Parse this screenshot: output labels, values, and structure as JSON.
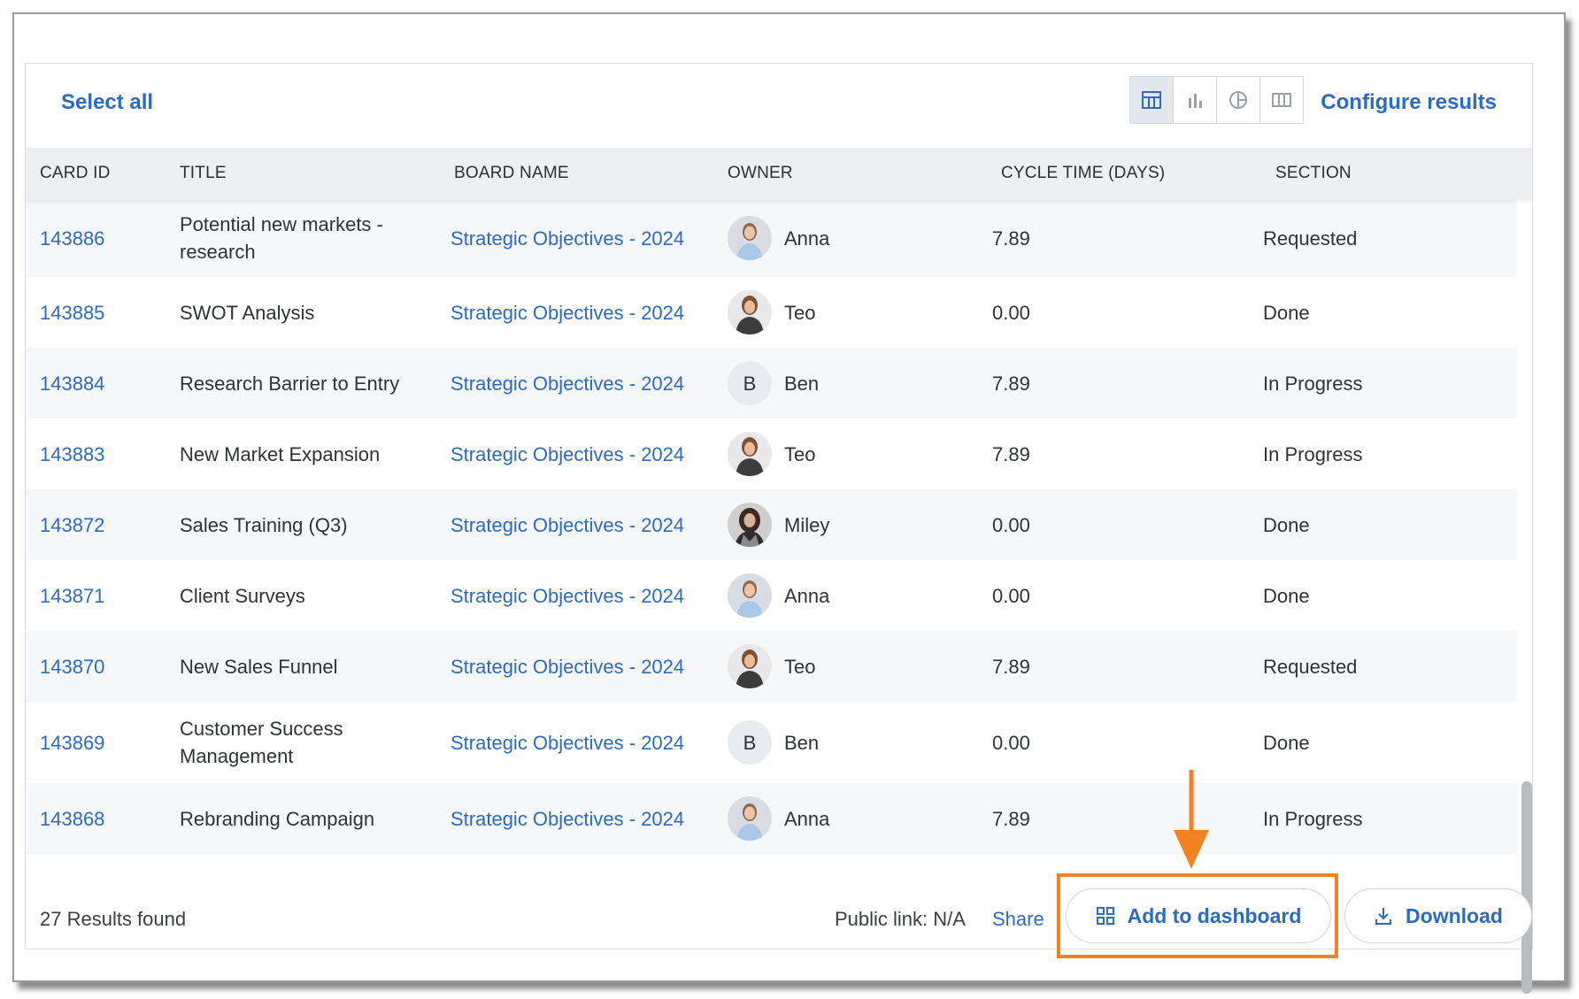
{
  "toolbar": {
    "select_all": "Select all",
    "configure_results": "Configure results",
    "view_modes": [
      "table-view-icon",
      "bar-chart-icon",
      "pie-chart-icon",
      "columns-view-icon"
    ]
  },
  "table": {
    "headers": {
      "card_id": "CARD ID",
      "title": "TITLE",
      "board_name": "BOARD NAME",
      "owner": "OWNER",
      "cycle_time": "CYCLE TIME (DAYS)",
      "section": "SECTION"
    },
    "rows": [
      {
        "card_id": "143886",
        "title": "Potential new markets - research",
        "board": "Strategic Objectives - 2024",
        "owner": "Anna",
        "avatar": "photo-anna",
        "cycle": "7.89",
        "section": "Requested"
      },
      {
        "card_id": "143885",
        "title": "SWOT Analysis",
        "board": "Strategic Objectives - 2024",
        "owner": "Teo",
        "avatar": "photo-teo",
        "cycle": "0.00",
        "section": "Done"
      },
      {
        "card_id": "143884",
        "title": "Research Barrier to Entry",
        "board": "Strategic Objectives - 2024",
        "owner": "Ben",
        "avatar": "B",
        "cycle": "7.89",
        "section": "In Progress"
      },
      {
        "card_id": "143883",
        "title": "New Market Expansion",
        "board": "Strategic Objectives - 2024",
        "owner": "Teo",
        "avatar": "photo-teo",
        "cycle": "7.89",
        "section": "In Progress"
      },
      {
        "card_id": "143872",
        "title": "Sales Training (Q3)",
        "board": "Strategic Objectives - 2024",
        "owner": "Miley",
        "avatar": "photo-miley",
        "cycle": "0.00",
        "section": "Done"
      },
      {
        "card_id": "143871",
        "title": "Client Surveys",
        "board": "Strategic Objectives - 2024",
        "owner": "Anna",
        "avatar": "photo-anna",
        "cycle": "0.00",
        "section": "Done"
      },
      {
        "card_id": "143870",
        "title": "New Sales Funnel",
        "board": "Strategic Objectives - 2024",
        "owner": "Teo",
        "avatar": "photo-teo",
        "cycle": "7.89",
        "section": "Requested"
      },
      {
        "card_id": "143869",
        "title": "Customer Success Management",
        "board": "Strategic Objectives - 2024",
        "owner": "Ben",
        "avatar": "B",
        "cycle": "0.00",
        "section": "Done"
      },
      {
        "card_id": "143868",
        "title": "Rebranding Campaign",
        "board": "Strategic Objectives - 2024",
        "owner": "Anna",
        "avatar": "photo-anna",
        "cycle": "7.89",
        "section": "In Progress"
      }
    ]
  },
  "footer": {
    "results_count": "27 Results found",
    "public_link": "Public link: N/A",
    "share": "Share",
    "add_to_dashboard": "Add to dashboard",
    "download": "Download"
  },
  "colors": {
    "link": "#2d6bbd",
    "header_bg": "#edf0f3",
    "row_shade": "#f6f7f8",
    "highlight": "#f58220"
  }
}
